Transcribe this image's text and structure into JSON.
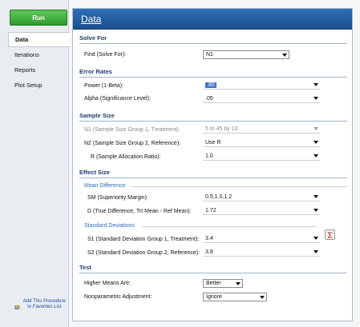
{
  "left": {
    "run_label": "Run",
    "nav": [
      {
        "label": "Data"
      },
      {
        "label": "Iterations"
      },
      {
        "label": "Reports"
      },
      {
        "label": "Plot Setup"
      }
    ],
    "favorites_label": "Add This Procedure to Favorites List"
  },
  "main": {
    "title": "Data",
    "solve_for": {
      "heading": "Solve For",
      "find_label": "Find (Solve For):",
      "find_value": "N1"
    },
    "error_rates": {
      "heading": "Error Rates",
      "power_label": "Power (1-Beta):",
      "power_value": ".80",
      "alpha_label": "Alpha (Significance Level):",
      "alpha_value": ".05"
    },
    "sample_size": {
      "heading": "Sample Size",
      "n1_label": "N1 (Sample Size Group 1, Treatment):",
      "n1_value": "5 to 45 by 10",
      "n2_label": "N2 (Sample Size Group 2, Reference):",
      "n2_value": "Use R",
      "r_label": "R (Sample Allocation Ratio):",
      "r_value": "1.0"
    },
    "effect_size": {
      "heading": "Effect Size",
      "mean_diff_heading": "Mean Difference",
      "sm_label": "SM (Superiority Margin):",
      "sm_value": "0.5,1.0,1.2",
      "d_label": "D (True Difference, Trt Mean - Ref Mean):",
      "d_value": "1.72",
      "std_dev_heading": "Standard Deviations",
      "s1_label": "S1 (Standard Deviation Group 1, Treatment):",
      "s1_value": "3.4",
      "s2_label": "S2 (Standard Deviation Group 2, Reference):",
      "s2_value": "3.8"
    },
    "test": {
      "heading": "Test",
      "higher_label": "Higher Means Are:",
      "higher_value": "Better",
      "nonparam_label": "Nonparametric Adjustment:",
      "nonparam_value": "Ignore"
    }
  },
  "colors": {
    "run_green": "#2f9a2b",
    "header_blue": "#1c4f8d",
    "section_text": "#1c3f6e",
    "subsection_text": "#2f6db4",
    "selection": "#3a73c4"
  },
  "icons": [
    "chevron-down-icon",
    "sigma-icon",
    "favorites-icon"
  ]
}
